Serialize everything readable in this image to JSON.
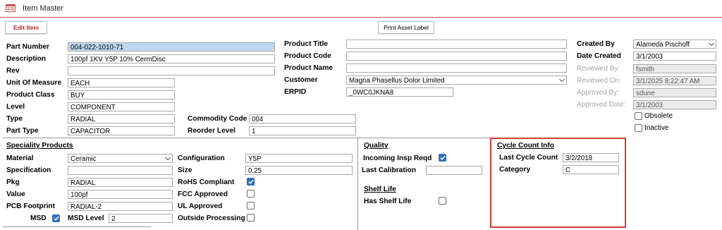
{
  "window": {
    "title": "Item Master"
  },
  "toolbar": {
    "edit_label": "Edit Item",
    "print_label": "Print Asset Label"
  },
  "main": {
    "part_number": {
      "label": "Part Number",
      "value": "004-022-1010-71"
    },
    "description": {
      "label": "Description",
      "value": "100pf 1KV Y5P 10% CermDisc"
    },
    "rev": {
      "label": "Rev",
      "value": ""
    },
    "uom": {
      "label": "Unit Of Measure",
      "value": "EACH"
    },
    "product_class": {
      "label": "Product Class",
      "value": "BUY"
    },
    "level": {
      "label": "Level",
      "value": "COMPONENT"
    },
    "type": {
      "label": "Type",
      "value": "RADIAL"
    },
    "part_type": {
      "label": "Part Type",
      "value": "CAPACITOR"
    },
    "commodity_code": {
      "label": "Commodity Code",
      "value": "004"
    },
    "reorder_level": {
      "label": "Reorder Level",
      "value": "1"
    },
    "product_title": {
      "label": "Product Title",
      "value": ""
    },
    "product_code": {
      "label": "Product Code",
      "value": ""
    },
    "product_name": {
      "label": "Product Name",
      "value": ""
    },
    "customer": {
      "label": "Customer",
      "value": "Magna Phasellus Dolor Limited"
    },
    "erpid": {
      "label": "ERPID",
      "value": "_0WC0JKNA8"
    }
  },
  "audit": {
    "created_by": {
      "label": "Created By",
      "value": "Alameda Pischoff"
    },
    "date_created": {
      "label": "Date Created",
      "value": "3/1/2003"
    },
    "reviewed_by": {
      "label": "Reviewed By:",
      "value": "fsmith"
    },
    "reviewed_on": {
      "label": "Reviewed On:",
      "value": "3/1/2025 8:22:47 AM"
    },
    "approved_by": {
      "label": "Approved By:",
      "value": "sdune"
    },
    "approved_date": {
      "label": "Approved Date:",
      "value": "3/1/2003"
    },
    "obsolete": {
      "label": "Obsolete",
      "checked": false
    },
    "inactive": {
      "label": "Inactive",
      "checked": false
    }
  },
  "speciality": {
    "heading": "Speciality Products",
    "material": {
      "label": "Material",
      "value": "Ceramic"
    },
    "specification": {
      "label": "Specification",
      "value": ""
    },
    "pkg": {
      "label": "Pkg",
      "value": "RADIAL"
    },
    "value": {
      "label": "Value",
      "value": "100pf"
    },
    "pcb_footprint": {
      "label": "PCB Footprint",
      "value": "RADIAL-2"
    },
    "msd": {
      "label": "MSD",
      "checked": true
    },
    "msd_level": {
      "label": "MSD Level",
      "value": "2"
    },
    "configuration": {
      "label": "Configuration",
      "value": "Y5P"
    },
    "size": {
      "label": "Size",
      "value": "0.25"
    },
    "rohs": {
      "label": "RoHS Compliant",
      "checked": true
    },
    "fcc": {
      "label": "FCC Approved",
      "checked": false
    },
    "ul": {
      "label": "UL Approved",
      "checked": false
    },
    "outside_processing": {
      "label": "Outside Processing",
      "checked": false
    }
  },
  "quality": {
    "heading": "Quality",
    "incoming_insp": {
      "label": "Incoming Insp Reqd",
      "checked": true
    },
    "last_calibration": {
      "label": "Last Calibration",
      "value": ""
    },
    "shelf_heading": "Shelf Life",
    "has_shelf_life": {
      "label": "Has Shelf Life",
      "checked": false
    }
  },
  "cycle": {
    "heading": "Cycle Count Info",
    "last_cycle_count": {
      "label": "Last Cycle Count",
      "value": "3/2/2018"
    },
    "category": {
      "label": "Category",
      "value": "C"
    }
  },
  "colors": {
    "accent_red": "#d83a34",
    "highlight": "#bfd8f2",
    "check_blue": "#2f6fbd"
  }
}
